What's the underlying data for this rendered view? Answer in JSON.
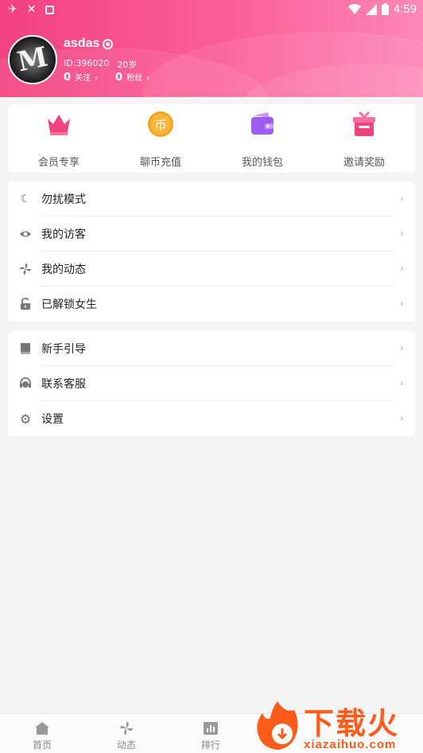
{
  "status_bar": {
    "time": "4:59"
  },
  "profile": {
    "username": "asdas",
    "id_text": "ID:396020",
    "age": "20岁",
    "following_count": "0",
    "following_label": "关注",
    "followers_count": "0",
    "followers_label": "粉丝"
  },
  "quick_actions": [
    {
      "label": "会员专享",
      "icon": "crown-icon",
      "color": "#f2417f"
    },
    {
      "label": "聊币充值",
      "icon": "coin-icon",
      "color": "#f8a21d"
    },
    {
      "label": "我的钱包",
      "icon": "wallet-icon",
      "color": "#a05cf0"
    },
    {
      "label": "邀请奖励",
      "icon": "gift-icon",
      "color": "#f2417f"
    }
  ],
  "menu_group_1": [
    {
      "label": "勿扰模式",
      "icon": "moon-icon"
    },
    {
      "label": "我的访客",
      "icon": "eye-icon"
    },
    {
      "label": "我的动态",
      "icon": "pinwheel-icon"
    },
    {
      "label": "已解锁女生",
      "icon": "unlock-icon"
    }
  ],
  "menu_group_2": [
    {
      "label": "新手引导",
      "icon": "book-icon"
    },
    {
      "label": "联系客服",
      "icon": "headset-icon"
    },
    {
      "label": "设置",
      "icon": "gear-icon"
    }
  ],
  "tab_bar": [
    {
      "label": "首页",
      "icon": "home-icon"
    },
    {
      "label": "动态",
      "icon": "pinwheel-icon"
    },
    {
      "label": "排行",
      "icon": "ranking-icon"
    }
  ],
  "watermark": {
    "brand_cn": "下载火",
    "brand_en": "xiazaihuo.com"
  },
  "colors": {
    "accent": "#f2417f",
    "background": "#f4f4f4",
    "watermark": "#ff5b1a"
  }
}
